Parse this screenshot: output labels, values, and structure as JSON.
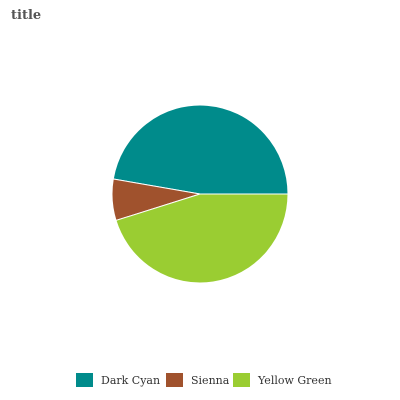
{
  "chart_data": {
    "type": "pie",
    "title": "title",
    "categories": [
      "Dark Cyan",
      "Sienna",
      "Yellow Green"
    ],
    "values": [
      47.3,
      7.5,
      45.2
    ],
    "colors": [
      "#008b8b",
      "#a0522d",
      "#9acd32"
    ],
    "start_angle_deg": 90,
    "direction": "clockwise",
    "legend_position": "bottom"
  }
}
